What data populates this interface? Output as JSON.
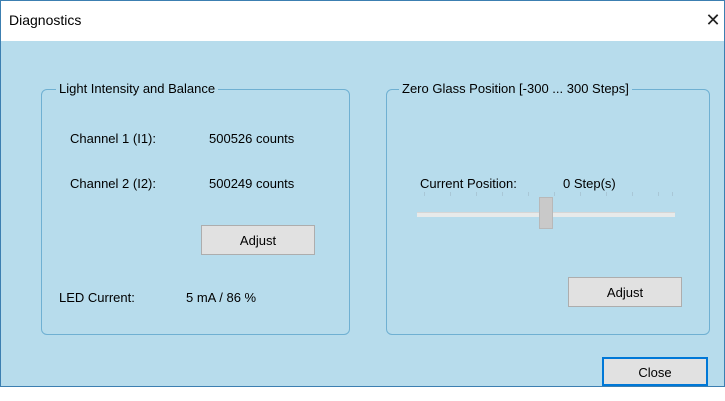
{
  "window": {
    "title": "Diagnostics",
    "close_icon": "close-icon"
  },
  "light_group": {
    "title": "Light Intensity and Balance",
    "channel1_label": "Channel 1 (I1):",
    "channel1_value": "500526 counts",
    "channel2_label": "Channel 2 (I2):",
    "channel2_value": "500249 counts",
    "adjust_label": "Adjust",
    "led_label": "LED Current:",
    "led_value": "5 mA / 86 %"
  },
  "zero_group": {
    "title": "Zero Glass Position [-300 ... 300 Steps]",
    "slider": {
      "min": -300,
      "max": 300,
      "value": 0
    },
    "position_label": "Current Position:",
    "position_value": "0 Step(s)",
    "adjust_label": "Adjust"
  },
  "footer": {
    "close_label": "Close"
  }
}
